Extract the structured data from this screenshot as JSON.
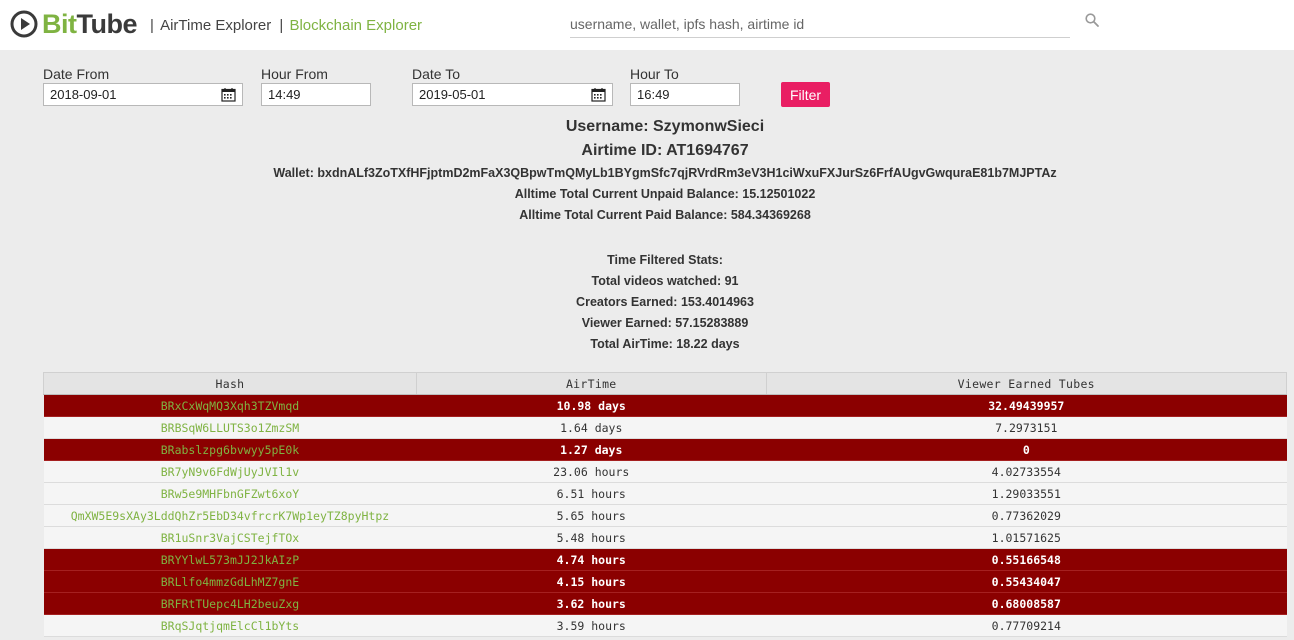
{
  "header": {
    "logo_bit": "Bit",
    "logo_tube": "Tube",
    "nav_separator": "|",
    "nav_airtime": "AirTime Explorer",
    "nav_blockchain": "Blockchain Explorer",
    "search_placeholder": "username, wallet, ipfs hash, airtime id"
  },
  "filters": {
    "date_from_label": "Date From",
    "date_from_value": "2018-09-01",
    "hour_from_label": "Hour From",
    "hour_from_value": "14:49",
    "date_to_label": "Date To",
    "date_to_value": "2019-05-01",
    "hour_to_label": "Hour To",
    "hour_to_value": "16:49",
    "filter_button": "Filter"
  },
  "account": {
    "username": "Username: SzymonwSieci",
    "airtime_id": "Airtime ID: AT1694767",
    "wallet": "Wallet: bxdnALf3ZoTXfHFjptmD2mFaX3QBpwTmQMyLb1BYgmSfc7qjRVrdRm3eV3H1ciWxuFXJurSz6FrfAUgvGwquraE81b7MJPTAz",
    "unpaid_balance": "Alltime Total Current Unpaid Balance: 15.12501022",
    "paid_balance": "Alltime Total Current Paid Balance: 584.34369268"
  },
  "stats": {
    "title": "Time Filtered Stats:",
    "videos_watched": "Total videos watched: 91",
    "creators_earned": "Creators Earned: 153.4014963",
    "viewer_earned": "Viewer Earned: 57.15283889",
    "total_airtime": "Total AirTime: 18.22 days"
  },
  "table": {
    "headers": [
      "Hash",
      "AirTime",
      "Viewer Earned Tubes"
    ],
    "rows": [
      {
        "hash": "BRxCxWqMQ3Xqh3TZVmqd",
        "airtime": "10.98 days",
        "earned": "32.49439957",
        "highlight": true
      },
      {
        "hash": "BRBSqW6LLUTS3o1ZmzSM",
        "airtime": "1.64 days",
        "earned": "7.2973151",
        "highlight": false
      },
      {
        "hash": "BRabslzpg6bvwyy5pE0k",
        "airtime": "1.27 days",
        "earned": "0",
        "highlight": true
      },
      {
        "hash": "BR7yN9v6FdWjUyJVIl1v",
        "airtime": "23.06 hours",
        "earned": "4.02733554",
        "highlight": false
      },
      {
        "hash": "BRw5e9MHFbnGFZwt6xoY",
        "airtime": "6.51 hours",
        "earned": "1.29033551",
        "highlight": false
      },
      {
        "hash": "QmXW5E9sXAy3LddQhZr5EbD34vfrcrK7Wp1eyTZ8pyHtpz",
        "airtime": "5.65 hours",
        "earned": "0.77362029",
        "highlight": false
      },
      {
        "hash": "BR1uSnr3VajCSTejfTOx",
        "airtime": "5.48 hours",
        "earned": "1.01571625",
        "highlight": false
      },
      {
        "hash": "BRYYlwL573mJJ2JkAIzP",
        "airtime": "4.74 hours",
        "earned": "0.55166548",
        "highlight": true
      },
      {
        "hash": "BRLlfo4mmzGdLhMZ7gnE",
        "airtime": "4.15 hours",
        "earned": "0.55434047",
        "highlight": true
      },
      {
        "hash": "BRFRtTUepc4LH2beuZxg",
        "airtime": "3.62 hours",
        "earned": "0.68008587",
        "highlight": true
      },
      {
        "hash": "BRqSJqtjqmElcCl1bYts",
        "airtime": "3.59 hours",
        "earned": "0.77709214",
        "highlight": false
      }
    ]
  },
  "colors": {
    "accent_green": "#7fb342",
    "highlight_row": "#8b0000",
    "filter_button": "#e91e63"
  },
  "icons": {
    "logo": "play-circle-icon",
    "search": "search-icon",
    "calendar": "calendar-icon"
  }
}
